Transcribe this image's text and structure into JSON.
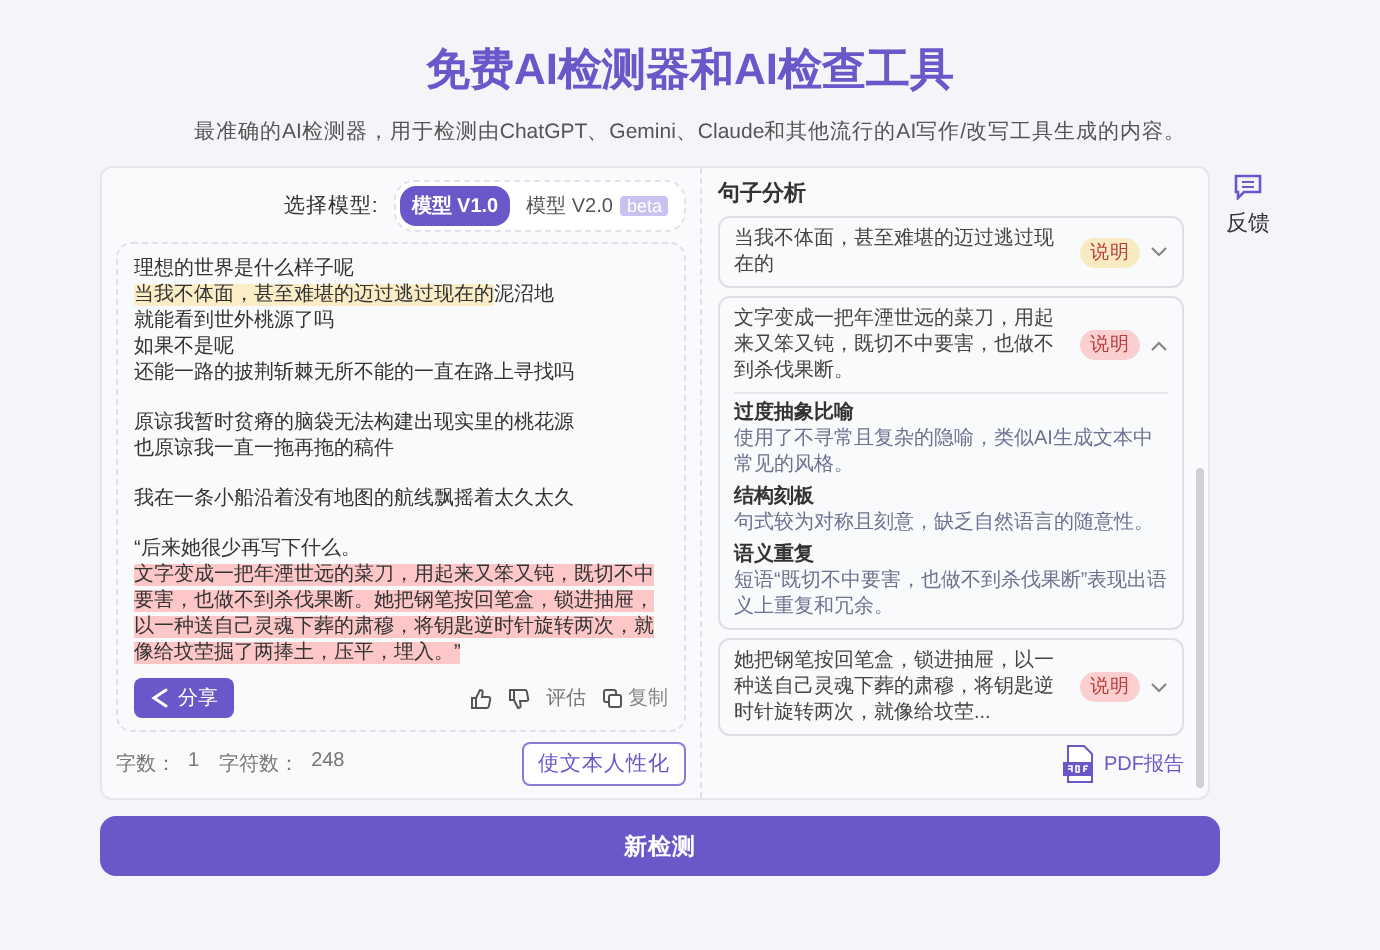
{
  "title": "免费AI检测器和AI检查工具",
  "subtitle": "最准确的AI检测器，用于检测由ChatGPT、Gemini、Claude和其他流行的AI写作/改写工具生成的内容。",
  "model_selector": {
    "label": "选择模型:",
    "options": [
      {
        "label": "模型 V1.0",
        "selected": true
      },
      {
        "label": "模型 V2.0",
        "badge": "beta",
        "selected": false
      }
    ]
  },
  "editor": {
    "paragraphs": [
      {
        "lines": [
          [
            {
              "text": "理想的世界是什么样子呢"
            }
          ],
          [
            {
              "text": "当我不体面，甚至难堪的迈过逃过现在的",
              "color": "#fbedc6"
            },
            {
              "text": "泥沼地"
            }
          ],
          [
            {
              "text": "就能看到世外桃源了吗"
            }
          ],
          [
            {
              "text": "如果不是呢"
            }
          ],
          [
            {
              "text": "还能一路的披荆斩棘无所不能的一直在路上寻找吗"
            }
          ]
        ]
      },
      {
        "lines": [
          [
            {
              "text": "原谅我暂时贫瘠的脑袋无法构建出现实里的桃花源"
            }
          ],
          [
            {
              "text": "也原谅我一直一拖再拖的稿件"
            }
          ]
        ]
      },
      {
        "lines": [
          [
            {
              "text": "我在一条小船沿着没有地图的航线飘摇着太久太久"
            }
          ]
        ]
      },
      {
        "lines": [
          [
            {
              "text": "“后来她很少再写下什么。"
            }
          ],
          [
            {
              "text": "文字变成一把年湮世远的菜刀，用起来又笨又钝，既切不中要害，也做不到杀伐果断。她把钢笔按回笔盒，锁进抽屉，以一种送自己灵魂下葬的肃穆，将钥匙逆时针旋转两次，就像给坟茔掘了两捧土，压平，埋入。”",
              "color": "#fdc7c7"
            }
          ]
        ]
      }
    ],
    "share": "分享",
    "rate": "评估",
    "copy": "复制"
  },
  "stats": [
    {
      "label": "字数：",
      "value": "1"
    },
    {
      "label": "字符数：",
      "value": "248"
    }
  ],
  "humanize": "使文本人性化",
  "analysis": {
    "title": "句子分析",
    "items": [
      {
        "text": "当我不体面，甚至难堪的迈过逃过现在的",
        "badge": "说明",
        "color": "#f8ebc1",
        "expanded": false
      },
      {
        "text": "文字变成一把年湮世远的菜刀，用起来又笨又钝，既切不中要害，也做不到杀伐果断。",
        "badge": "说明",
        "color": "#fbcfcf",
        "expanded": true,
        "details": [
          {
            "title": "过度抽象比喻",
            "description": "使用了不寻常且复杂的隐喻，类似AI生成文本中常见的风格。"
          },
          {
            "title": "结构刻板",
            "description": "句式较为对称且刻意，缺乏自然语言的随意性。"
          },
          {
            "title": "语义重复",
            "description": "短语“既切不中要害，也做不到杀伐果断”表现出语义上重复和冗余。"
          }
        ]
      },
      {
        "text": "她把钢笔按回笔盒，锁进抽屉，以一种送自己灵魂下葬的肃穆，将钥匙逆时针旋转两次，就像给坟茔...",
        "badge": "说明",
        "color": "#fbcfcf",
        "expanded": false
      }
    ],
    "pdf": "PDF报告"
  },
  "feedback": "反馈",
  "new_check": "新检测"
}
